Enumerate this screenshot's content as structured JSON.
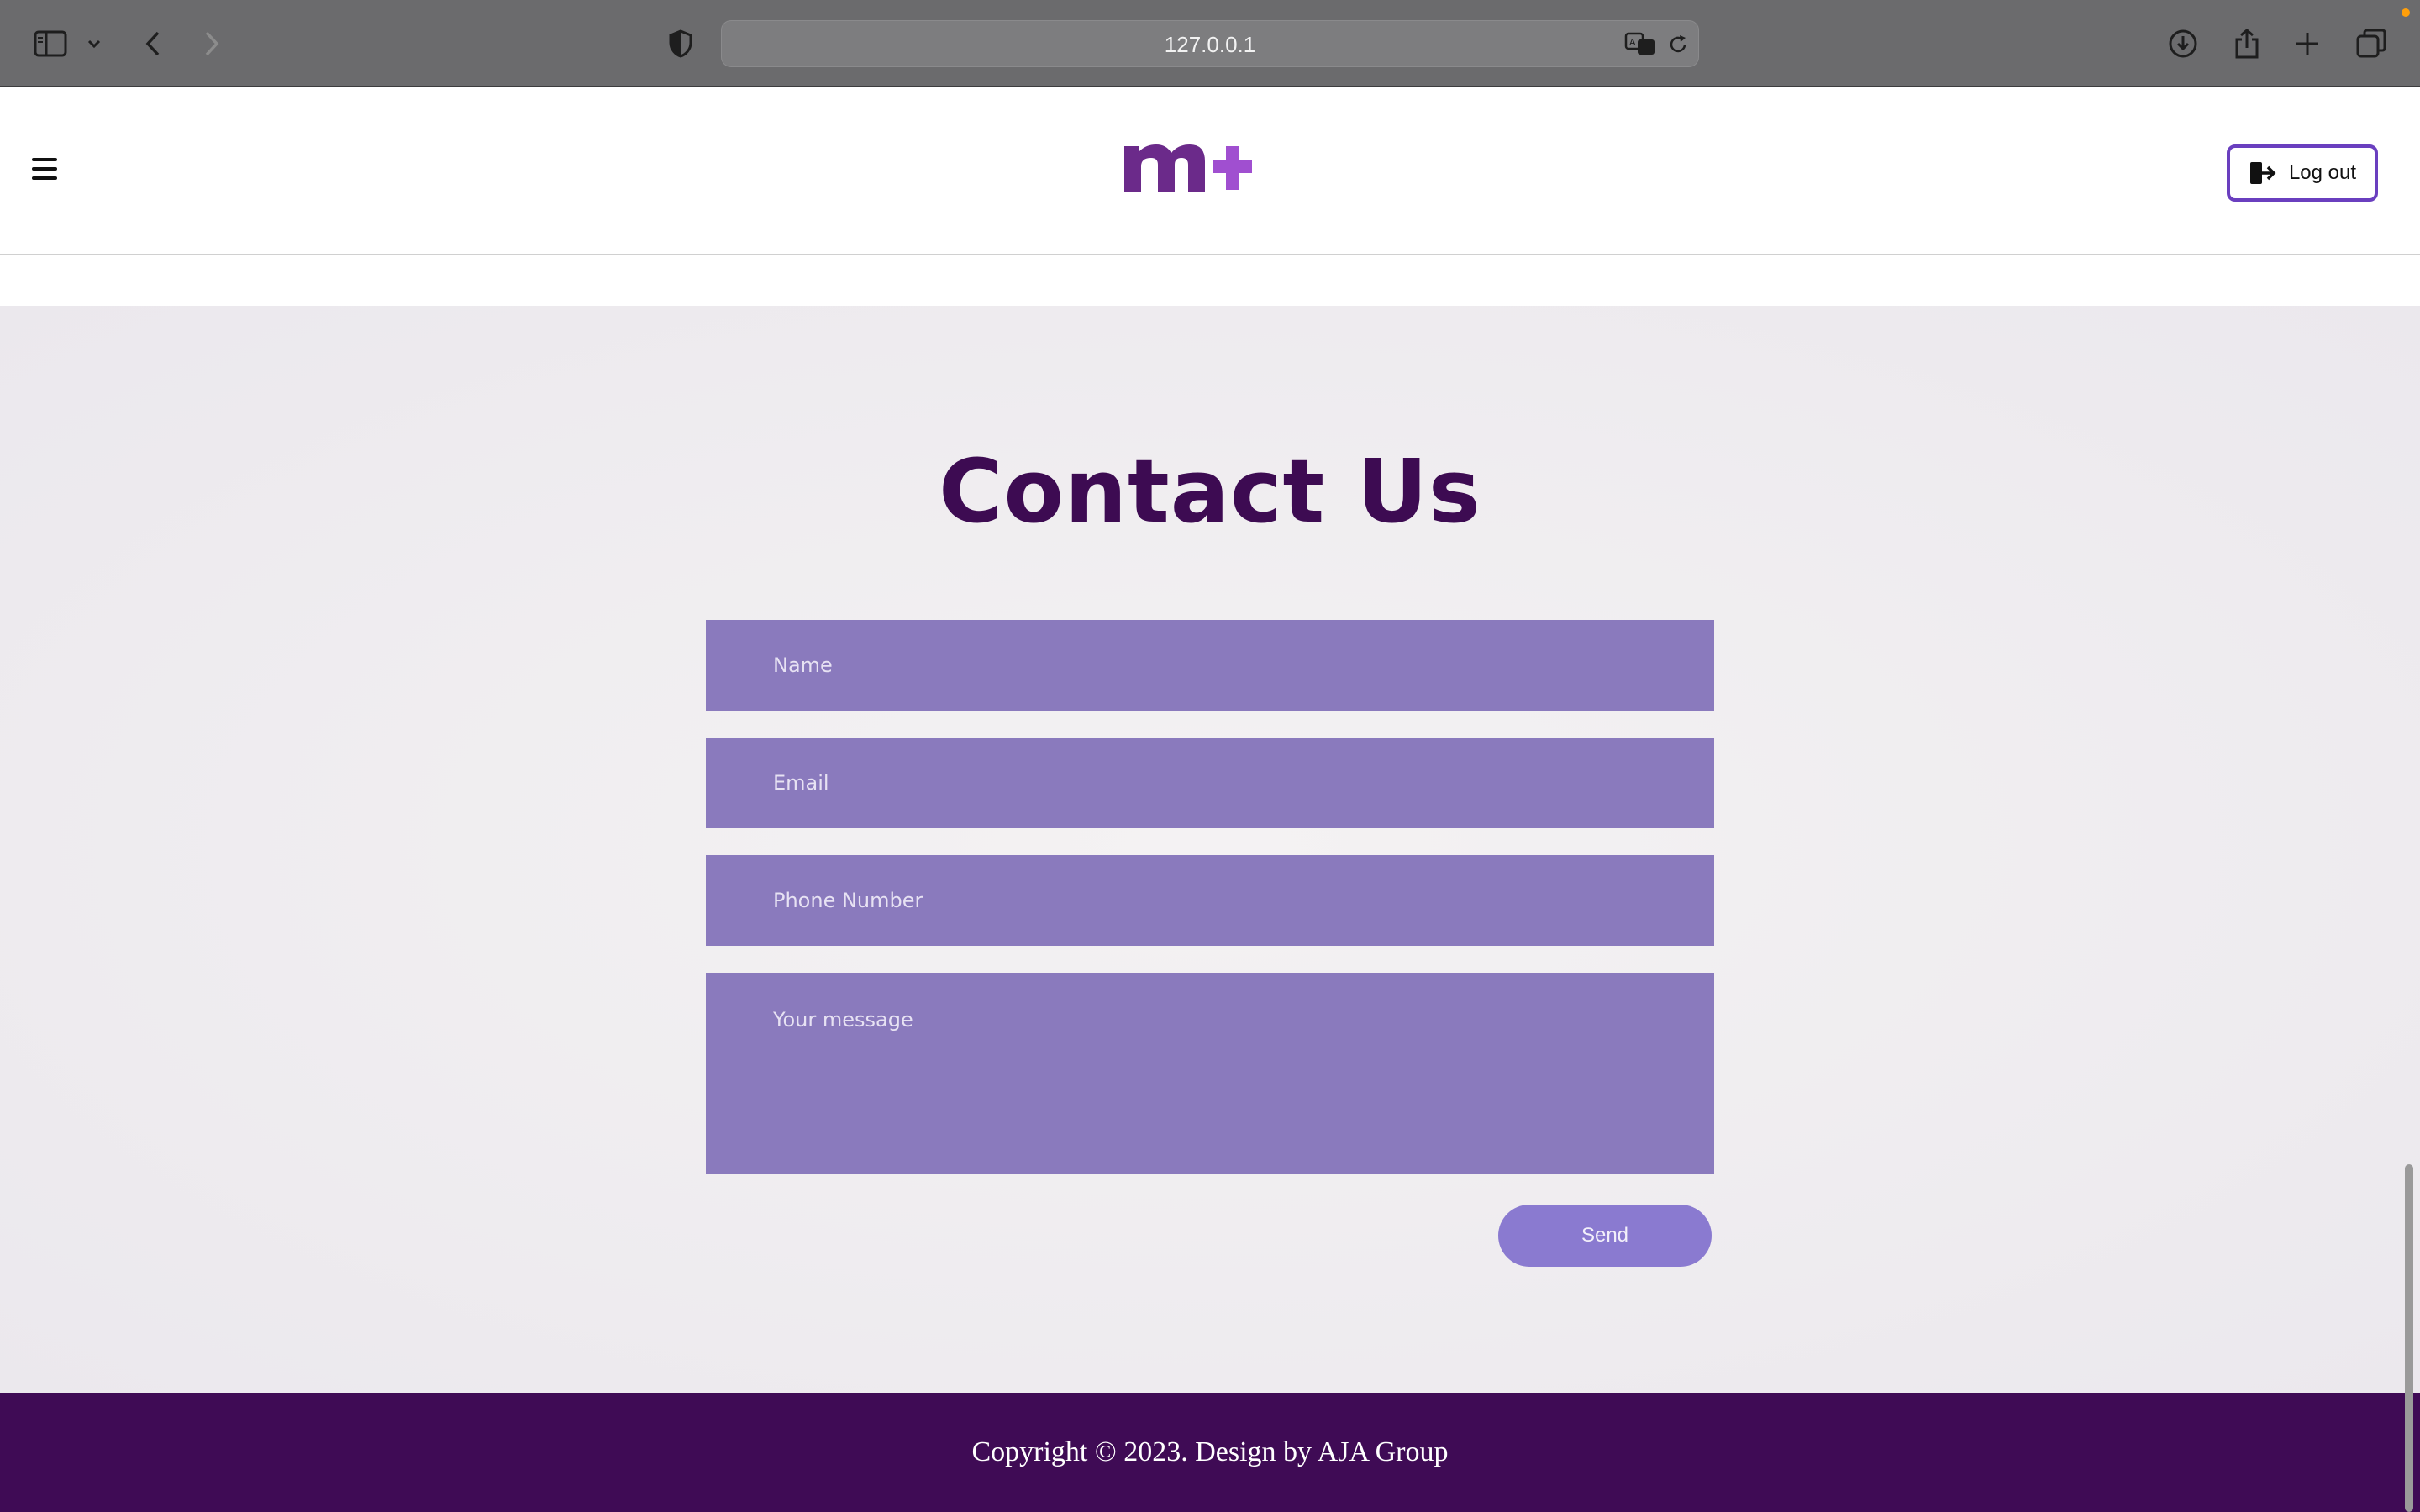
{
  "browser": {
    "url": "127.0.0.1",
    "icons": [
      "sidebar-icon",
      "chevron-down-icon",
      "back-icon",
      "forward-icon",
      "privacy-shield-icon",
      "translate-icon",
      "reload-icon",
      "download-icon",
      "share-icon",
      "new-tab-icon",
      "tab-overview-icon"
    ]
  },
  "header": {
    "logo_text": "m+",
    "logout_label": "Log out",
    "colors": {
      "logo_m": "#6b2a8a",
      "logo_plus": "#a04fd0",
      "logout_border": "#6a3fbf"
    }
  },
  "contact": {
    "title": "Contact Us",
    "fields": {
      "name_placeholder": "Name",
      "email_placeholder": "Email",
      "phone_placeholder": "Phone Number",
      "message_placeholder": "Your message"
    },
    "send_label": "Send",
    "colors": {
      "title": "#3d0b52",
      "field_bg": "#8a7abd",
      "button_bg": "#8a7ad0"
    }
  },
  "footer": {
    "text": "Copyright © 2023. Design by AJA Group",
    "colors": {
      "bg": "#3f0b55"
    }
  }
}
